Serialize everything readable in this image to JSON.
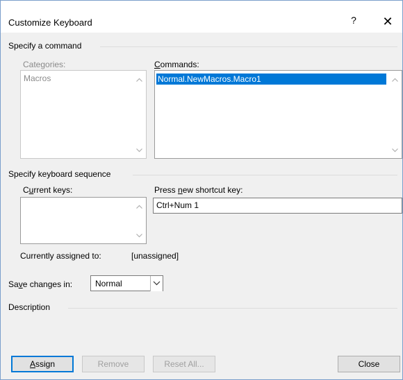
{
  "dialog": {
    "title": "Customize Keyboard",
    "help_glyph": "?",
    "close_glyph": "✕"
  },
  "specify_command": {
    "group_label": "Specify a command",
    "categories_label": "Categories:",
    "categories": [
      "Macros"
    ],
    "commands_label_pre": "",
    "commands_label_ul": "C",
    "commands_label_post": "ommands:",
    "commands": [
      "Normal.NewMacros.Macro1"
    ]
  },
  "keyboard_sequence": {
    "group_label": "Specify keyboard sequence",
    "current_keys_label_pre": "C",
    "current_keys_label_ul": "u",
    "current_keys_label_post": "rrent keys:",
    "new_key_label_pre": "Press ",
    "new_key_label_ul": "n",
    "new_key_label_post": "ew shortcut key:",
    "new_key_value": "Ctrl+Num 1",
    "assigned_label": "Currently assigned to:",
    "assigned_value": "[unassigned]"
  },
  "save_changes": {
    "label_pre": "Sa",
    "label_ul": "v",
    "label_post": "e changes in:",
    "selected": "Normal"
  },
  "description": {
    "group_label": "Description"
  },
  "buttons": {
    "assign_ul": "A",
    "assign_post": "ssign",
    "remove": "Remove",
    "reset_all": "Reset All...",
    "close": "Close"
  },
  "colors": {
    "selection": "#0078d7",
    "dialog_bg": "#f0f0f0"
  }
}
